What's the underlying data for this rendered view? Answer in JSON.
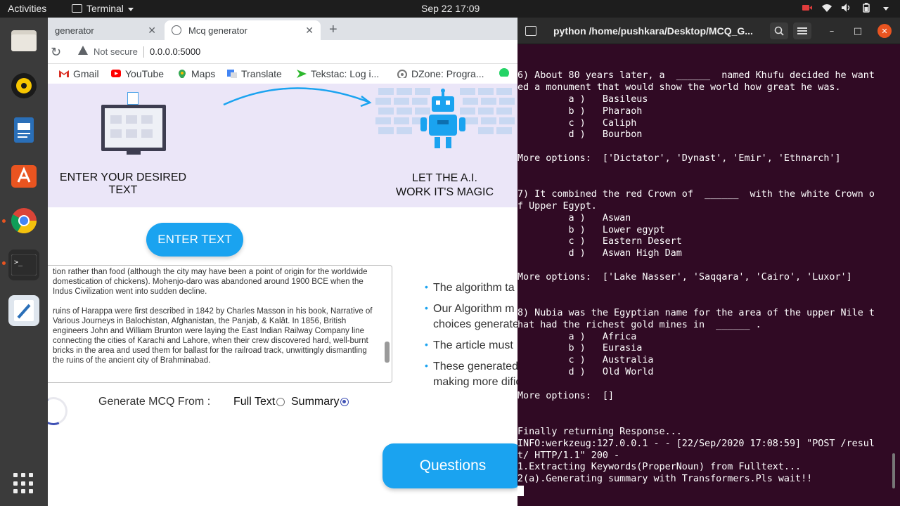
{
  "topbar": {
    "activities": "Activities",
    "app_name": "Terminal",
    "clock": "Sep 22  17:09"
  },
  "browser": {
    "tabs": [
      {
        "label": "generator",
        "partial": true
      },
      {
        "label": "Mcq generator"
      }
    ],
    "security": "Not secure",
    "url": "0.0.0.0:5000",
    "bookmarks": [
      "Gmail",
      "YouTube",
      "Maps",
      "Translate",
      "Tekstac: Log i...",
      "DZone: Progra..."
    ]
  },
  "page": {
    "step1": "ENTER YOUR DESIRED TEXT",
    "step2_line1": "LET THE A.I.",
    "step2_line2": "WORK IT'S MAGIC",
    "enter_button": "ENTER TEXT",
    "textarea_p1": "tion rather than food (although the city may have been a point of origin for the worldwide domestication of chickens). Mohenjo-daro was abandoned around 1900 BCE when the Indus Civilization went into sudden decline.",
    "textarea_p2": "ruins of Harappa were first described in 1842 by Charles Masson in his book, Narrative of Various Journeys in Balochistan, Afghanistan, the Panjab, & Kalât. In 1856, British engineers John and William Brunton were laying the East Indian Railway Company line connecting the cities of Karachi and Lahore, when their crew discovered hard, well-burnt bricks in the area and used them for ballast for the railroad track, unwittingly dismantling the ruins of the ancient city of Brahminabad.",
    "bullet1": "The algorithm ta",
    "bullet2a": "Our Algorithm m",
    "bullet2b": "choices generate",
    "bullet3": "The article must",
    "bullet4a": "These generated",
    "bullet4b": "making more dific",
    "generate_label": "Generate MCQ From :",
    "option_full": "Full Text",
    "option_summary": "Summary",
    "selected_option": "Summary",
    "questions_button": "Questions"
  },
  "terminal": {
    "title": "python /home/pushkara/Desktop/MCQ_G...",
    "lines": [
      "6) About 80 years later, a  ______  named Khufu decided he want",
      "ed a monument that would show the world how great he was.",
      "         a )   Basileus",
      "         b )   Pharaoh",
      "         c )   Caliph",
      "         d )   Bourbon",
      "",
      "More options:  ['Dictator', 'Dynast', 'Emir', 'Ethnarch']",
      "",
      "",
      "7) It combined the red Crown of  ______  with the white Crown o",
      "f Upper Egypt.",
      "         a )   Aswan",
      "         b )   Lower egypt",
      "         c )   Eastern Desert",
      "         d )   Aswan High Dam",
      "",
      "More options:  ['Lake Nasser', 'Saqqara', 'Cairo', 'Luxor']",
      "",
      "",
      "8) Nubia was the Egyptian name for the area of the upper Nile t",
      "hat had the richest gold mines in  ______ .",
      "         a )   Africa",
      "         b )   Eurasia",
      "         c )   Australia",
      "         d )   Old World",
      "",
      "More options:  []",
      "",
      "",
      "Finally returning Response...",
      "INFO:werkzeug:127.0.0.1 - - [22/Sep/2020 17:08:59] \"POST /resul",
      "t/ HTTP/1.1\" 200 -",
      "1.Extracting Keywords(ProperNoun) from Fulltext...",
      "2(a).Generating summary with Transformers.Pls wait!!"
    ]
  },
  "colors": {
    "accent_blue": "#1aa3f0",
    "hero_bg": "#ebe6f8",
    "terminal_bg": "#300a24",
    "ubuntu_orange": "#e95420"
  },
  "icons": {
    "dock": [
      "files-icon",
      "rhythmbox-icon",
      "document-viewer-icon",
      "software-center-icon",
      "chrome-icon",
      "terminal-icon",
      "text-editor-icon",
      "app-grid-icon"
    ]
  }
}
